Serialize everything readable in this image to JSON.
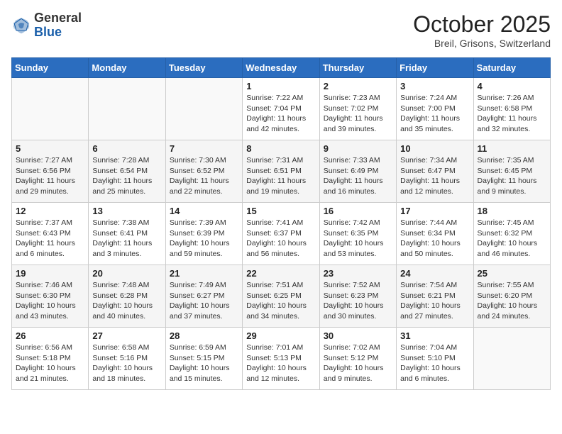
{
  "header": {
    "logo_general": "General",
    "logo_blue": "Blue",
    "month_title": "October 2025",
    "subtitle": "Breil, Grisons, Switzerland"
  },
  "days_of_week": [
    "Sunday",
    "Monday",
    "Tuesday",
    "Wednesday",
    "Thursday",
    "Friday",
    "Saturday"
  ],
  "weeks": [
    [
      {
        "day": "",
        "info": ""
      },
      {
        "day": "",
        "info": ""
      },
      {
        "day": "",
        "info": ""
      },
      {
        "day": "1",
        "info": "Sunrise: 7:22 AM\nSunset: 7:04 PM\nDaylight: 11 hours and 42 minutes."
      },
      {
        "day": "2",
        "info": "Sunrise: 7:23 AM\nSunset: 7:02 PM\nDaylight: 11 hours and 39 minutes."
      },
      {
        "day": "3",
        "info": "Sunrise: 7:24 AM\nSunset: 7:00 PM\nDaylight: 11 hours and 35 minutes."
      },
      {
        "day": "4",
        "info": "Sunrise: 7:26 AM\nSunset: 6:58 PM\nDaylight: 11 hours and 32 minutes."
      }
    ],
    [
      {
        "day": "5",
        "info": "Sunrise: 7:27 AM\nSunset: 6:56 PM\nDaylight: 11 hours and 29 minutes."
      },
      {
        "day": "6",
        "info": "Sunrise: 7:28 AM\nSunset: 6:54 PM\nDaylight: 11 hours and 25 minutes."
      },
      {
        "day": "7",
        "info": "Sunrise: 7:30 AM\nSunset: 6:52 PM\nDaylight: 11 hours and 22 minutes."
      },
      {
        "day": "8",
        "info": "Sunrise: 7:31 AM\nSunset: 6:51 PM\nDaylight: 11 hours and 19 minutes."
      },
      {
        "day": "9",
        "info": "Sunrise: 7:33 AM\nSunset: 6:49 PM\nDaylight: 11 hours and 16 minutes."
      },
      {
        "day": "10",
        "info": "Sunrise: 7:34 AM\nSunset: 6:47 PM\nDaylight: 11 hours and 12 minutes."
      },
      {
        "day": "11",
        "info": "Sunrise: 7:35 AM\nSunset: 6:45 PM\nDaylight: 11 hours and 9 minutes."
      }
    ],
    [
      {
        "day": "12",
        "info": "Sunrise: 7:37 AM\nSunset: 6:43 PM\nDaylight: 11 hours and 6 minutes."
      },
      {
        "day": "13",
        "info": "Sunrise: 7:38 AM\nSunset: 6:41 PM\nDaylight: 11 hours and 3 minutes."
      },
      {
        "day": "14",
        "info": "Sunrise: 7:39 AM\nSunset: 6:39 PM\nDaylight: 10 hours and 59 minutes."
      },
      {
        "day": "15",
        "info": "Sunrise: 7:41 AM\nSunset: 6:37 PM\nDaylight: 10 hours and 56 minutes."
      },
      {
        "day": "16",
        "info": "Sunrise: 7:42 AM\nSunset: 6:35 PM\nDaylight: 10 hours and 53 minutes."
      },
      {
        "day": "17",
        "info": "Sunrise: 7:44 AM\nSunset: 6:34 PM\nDaylight: 10 hours and 50 minutes."
      },
      {
        "day": "18",
        "info": "Sunrise: 7:45 AM\nSunset: 6:32 PM\nDaylight: 10 hours and 46 minutes."
      }
    ],
    [
      {
        "day": "19",
        "info": "Sunrise: 7:46 AM\nSunset: 6:30 PM\nDaylight: 10 hours and 43 minutes."
      },
      {
        "day": "20",
        "info": "Sunrise: 7:48 AM\nSunset: 6:28 PM\nDaylight: 10 hours and 40 minutes."
      },
      {
        "day": "21",
        "info": "Sunrise: 7:49 AM\nSunset: 6:27 PM\nDaylight: 10 hours and 37 minutes."
      },
      {
        "day": "22",
        "info": "Sunrise: 7:51 AM\nSunset: 6:25 PM\nDaylight: 10 hours and 34 minutes."
      },
      {
        "day": "23",
        "info": "Sunrise: 7:52 AM\nSunset: 6:23 PM\nDaylight: 10 hours and 30 minutes."
      },
      {
        "day": "24",
        "info": "Sunrise: 7:54 AM\nSunset: 6:21 PM\nDaylight: 10 hours and 27 minutes."
      },
      {
        "day": "25",
        "info": "Sunrise: 7:55 AM\nSunset: 6:20 PM\nDaylight: 10 hours and 24 minutes."
      }
    ],
    [
      {
        "day": "26",
        "info": "Sunrise: 6:56 AM\nSunset: 5:18 PM\nDaylight: 10 hours and 21 minutes."
      },
      {
        "day": "27",
        "info": "Sunrise: 6:58 AM\nSunset: 5:16 PM\nDaylight: 10 hours and 18 minutes."
      },
      {
        "day": "28",
        "info": "Sunrise: 6:59 AM\nSunset: 5:15 PM\nDaylight: 10 hours and 15 minutes."
      },
      {
        "day": "29",
        "info": "Sunrise: 7:01 AM\nSunset: 5:13 PM\nDaylight: 10 hours and 12 minutes."
      },
      {
        "day": "30",
        "info": "Sunrise: 7:02 AM\nSunset: 5:12 PM\nDaylight: 10 hours and 9 minutes."
      },
      {
        "day": "31",
        "info": "Sunrise: 7:04 AM\nSunset: 5:10 PM\nDaylight: 10 hours and 6 minutes."
      },
      {
        "day": "",
        "info": ""
      }
    ]
  ]
}
